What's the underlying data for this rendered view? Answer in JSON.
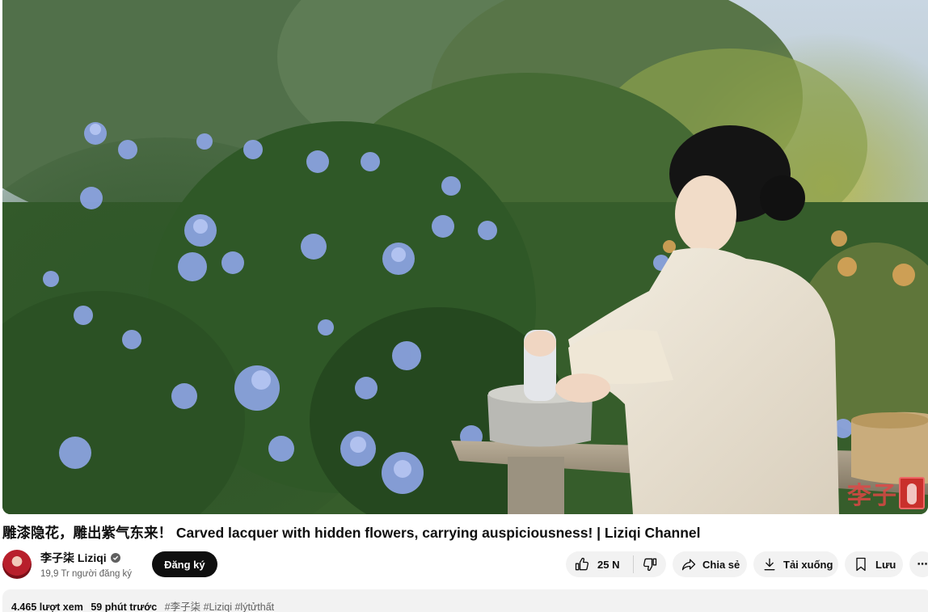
{
  "video": {
    "watermark_text": "李子"
  },
  "title": "雕漆隐花，雕出紫气东来！ Carved lacquer with hidden flowers, carrying auspiciousness! | Liziqi Channel",
  "channel": {
    "name": "李子柒 Liziqi",
    "subscribers": "19,9 Tr người đăng ký",
    "subscribe_label": "Đăng ký",
    "verified_icon": "check-circle-icon"
  },
  "actions": {
    "like_count": "25 N",
    "share_label": "Chia sẻ",
    "download_label": "Tải xuống",
    "save_label": "Lưu",
    "more_label": "⋯"
  },
  "description": {
    "views": "4.465 lượt xem",
    "time": "59 phút trước",
    "tags": "#李子柒 #Liziqi #lýtửthất"
  },
  "colors": {
    "subscribe_bg": "#0f0f0f",
    "pill_bg": "#f2f2f2",
    "secondary_text": "#606060"
  }
}
